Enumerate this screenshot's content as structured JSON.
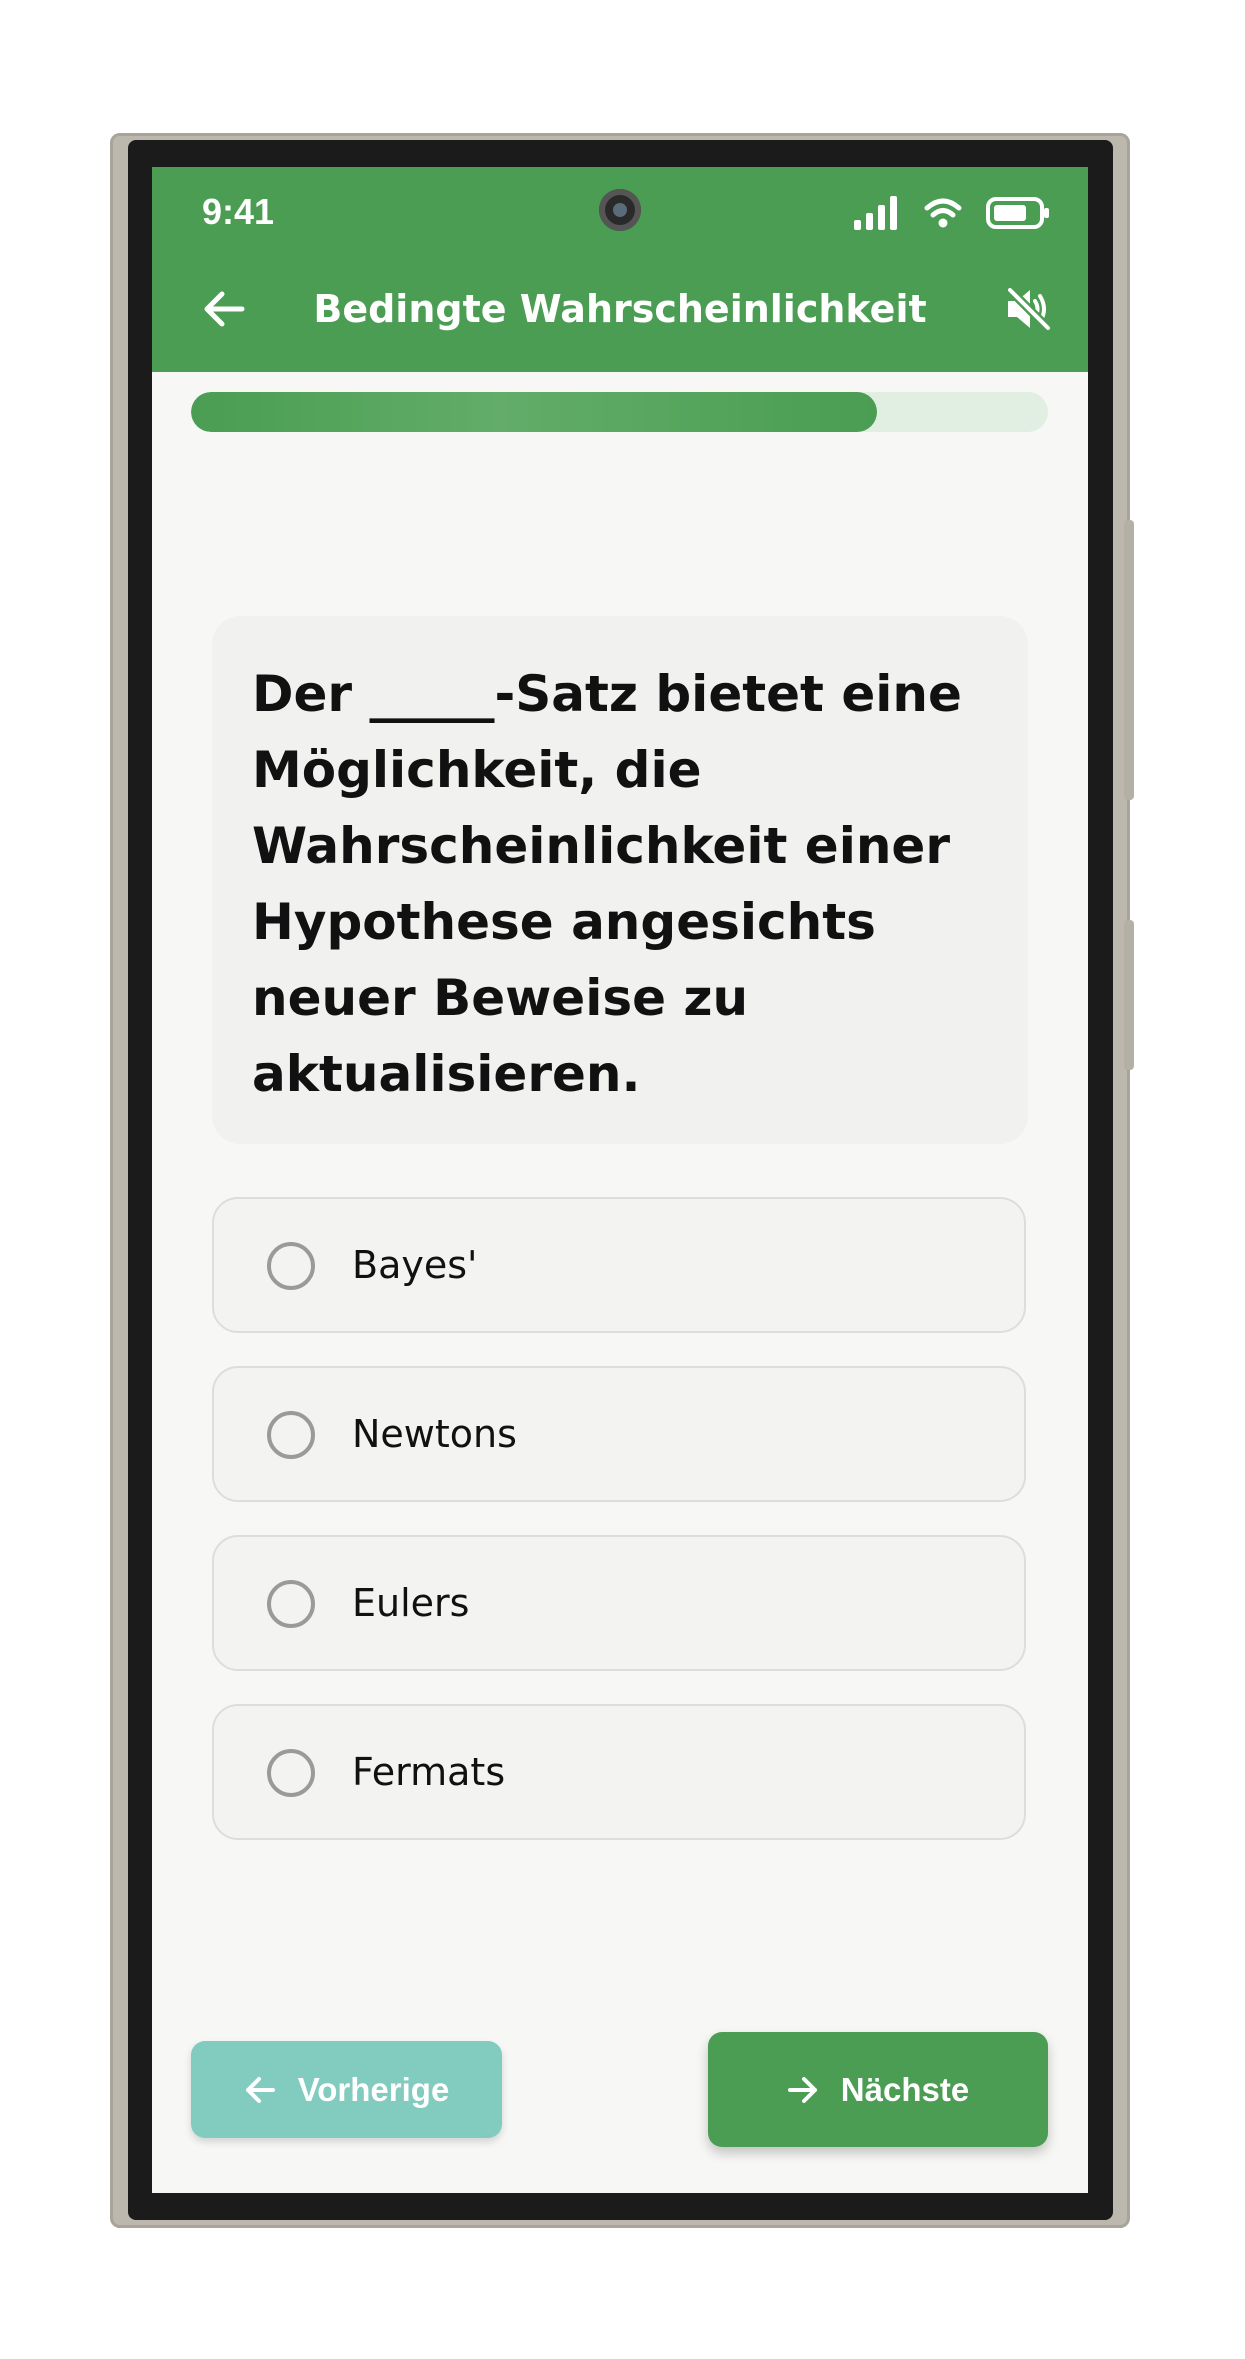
{
  "status_bar": {
    "time": "9:41"
  },
  "header": {
    "title": "Bedingte Wahrscheinlichkeit",
    "back_icon": "arrow-left-icon",
    "sound_icon": "volume-muted-icon"
  },
  "progress": {
    "fraction": 0.8
  },
  "question": {
    "text": "Der _____-Satz bietet eine Möglichkeit, die Wahrscheinlichkeit einer Hypothese angesichts neuer Beweise zu aktualisieren."
  },
  "options": [
    {
      "label": "Bayes'"
    },
    {
      "label": "Newtons"
    },
    {
      "label": "Eulers"
    },
    {
      "label": "Fermats"
    }
  ],
  "navigation": {
    "prev_label": "Vorherige",
    "next_label": "Nächste"
  },
  "colors": {
    "primary": "#4a9d52",
    "secondary": "#82cbbf",
    "background": "#f7f8f6"
  }
}
